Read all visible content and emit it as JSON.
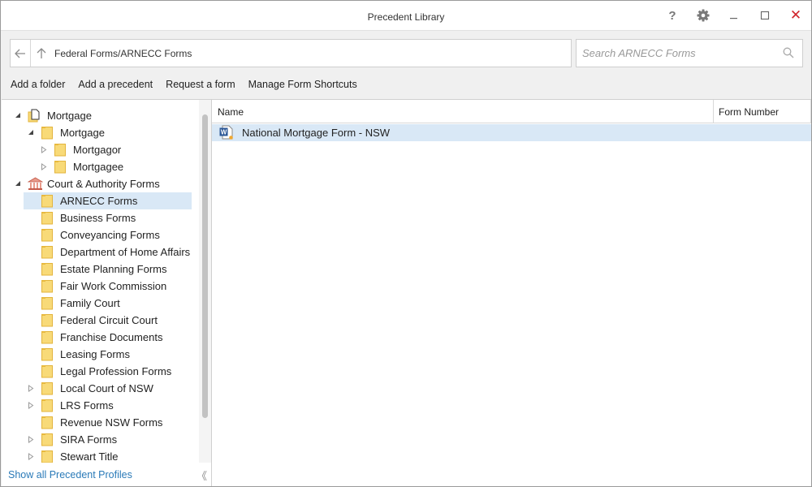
{
  "window": {
    "title": "Precedent Library",
    "help_label": "?",
    "close_label": "✕"
  },
  "address": {
    "path": "Federal Forms/ARNECC Forms"
  },
  "search": {
    "placeholder": "Search ARNECC Forms",
    "value": ""
  },
  "toolbar": {
    "add_folder": "Add a folder",
    "add_precedent": "Add a precedent",
    "request_form": "Request a form",
    "manage_shortcuts": "Manage Form Shortcuts"
  },
  "tree": {
    "items": [
      {
        "label": "Mortgage",
        "icon": "document-icon",
        "level": 0,
        "expander": "expanded"
      },
      {
        "label": "Mortgage",
        "icon": "folder-icon",
        "level": 1,
        "expander": "expanded"
      },
      {
        "label": "Mortgagor",
        "icon": "folder-icon",
        "level": 2,
        "expander": "collapsed"
      },
      {
        "label": "Mortgagee",
        "icon": "folder-icon",
        "level": 2,
        "expander": "collapsed"
      },
      {
        "label": "Court & Authority Forms",
        "icon": "institution-icon",
        "level": 0,
        "expander": "expanded"
      },
      {
        "label": "ARNECC Forms",
        "icon": "folder-icon",
        "level": 1,
        "expander": "none",
        "selected": true
      },
      {
        "label": "Business Forms",
        "icon": "folder-icon",
        "level": 1,
        "expander": "none"
      },
      {
        "label": "Conveyancing Forms",
        "icon": "folder-icon",
        "level": 1,
        "expander": "none"
      },
      {
        "label": "Department of Home Affairs",
        "icon": "folder-icon",
        "level": 1,
        "expander": "none"
      },
      {
        "label": "Estate Planning Forms",
        "icon": "folder-icon",
        "level": 1,
        "expander": "none"
      },
      {
        "label": "Fair Work Commission",
        "icon": "folder-icon",
        "level": 1,
        "expander": "none"
      },
      {
        "label": "Family Court",
        "icon": "folder-icon",
        "level": 1,
        "expander": "none"
      },
      {
        "label": "Federal Circuit Court",
        "icon": "folder-icon",
        "level": 1,
        "expander": "none"
      },
      {
        "label": "Franchise Documents",
        "icon": "folder-icon",
        "level": 1,
        "expander": "none"
      },
      {
        "label": "Leasing Forms",
        "icon": "folder-icon",
        "level": 1,
        "expander": "none"
      },
      {
        "label": "Legal Profession Forms",
        "icon": "folder-icon",
        "level": 1,
        "expander": "none"
      },
      {
        "label": "Local Court of NSW",
        "icon": "folder-icon",
        "level": 1,
        "expander": "collapsed"
      },
      {
        "label": "LRS Forms",
        "icon": "folder-icon",
        "level": 1,
        "expander": "collapsed"
      },
      {
        "label": "Revenue NSW Forms",
        "icon": "folder-icon",
        "level": 1,
        "expander": "none"
      },
      {
        "label": "SIRA Forms",
        "icon": "folder-icon",
        "level": 1,
        "expander": "collapsed"
      },
      {
        "label": "Stewart Title",
        "icon": "folder-icon",
        "level": 1,
        "expander": "collapsed"
      }
    ],
    "footer_link": "Show all Precedent Profiles",
    "collapse_label": "《"
  },
  "list": {
    "columns": {
      "name": "Name",
      "form_number": "Form Number"
    },
    "rows": [
      {
        "name": "National Mortgage Form - NSW",
        "form_number": "",
        "icon": "word-document-icon"
      }
    ]
  },
  "colors": {
    "selection": "#d9e8f6",
    "link": "#2a7ab8",
    "close": "#d0242b",
    "folder": "#f7d669"
  }
}
